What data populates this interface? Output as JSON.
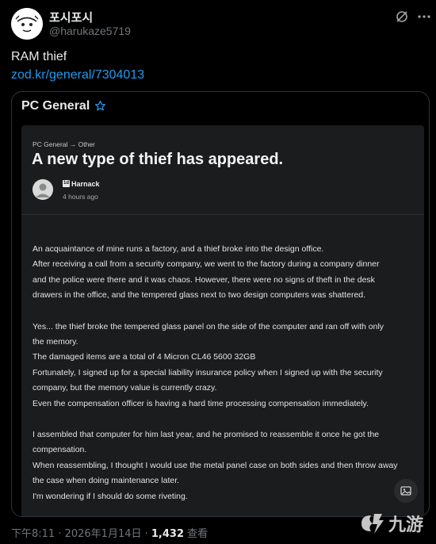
{
  "header": {
    "display_name": "포시포시",
    "handle": "@harukaze5719",
    "grok_icon": "grok-icon",
    "more_icon": "more-icon"
  },
  "tweet": {
    "text": "RAM thief",
    "link": "zod.kr/general/7304013"
  },
  "card": {
    "title": "PC General",
    "star_icon": "star-icon",
    "crumb": "PC General → Other",
    "post_title": "A new type of thief has appeared.",
    "author_badge": "1d",
    "author": "Harnack",
    "time": "4 hours ago",
    "body": [
      "An acquaintance of mine runs a factory, and a thief broke into the design office.",
      "After receiving a call from a security company, we went to the factory during a company dinner",
      "and the police were there and it was chaos. However, there were no signs of theft in the desk",
      "drawers in the office, and the tempered glass next to two design computers was shattered.",
      "Yes... the thief broke the tempered glass panel on the side of the computer and ran off with only",
      "the memory.",
      "The damaged items are a total of 4 Micron CL46 5600 32GB",
      "Fortunately, I signed up for a special liability insurance policy when I signed up with the security",
      "company, but the memory value is currently crazy.",
      "Even the compensation officer is having a hard time processing compensation immediately.",
      "I assembled that computer for him last year, and he promised to reassemble it once he got the",
      "compensation.",
      "When reassembling, I thought I would use the metal panel case on both sides and then throw away",
      "the case when doing maintenance later.",
      "I'm wondering if I should do some riveting."
    ]
  },
  "footer": {
    "time": "下午8:11 · 2026年1月14日 · ",
    "views": "1,432",
    "views_label": " 查看"
  },
  "watermark": {
    "text": "九游"
  },
  "colors": {
    "background": "#000000",
    "link": "#1d9bf0",
    "secondary": "#71767b",
    "card_inner": "#1b1c1d"
  }
}
